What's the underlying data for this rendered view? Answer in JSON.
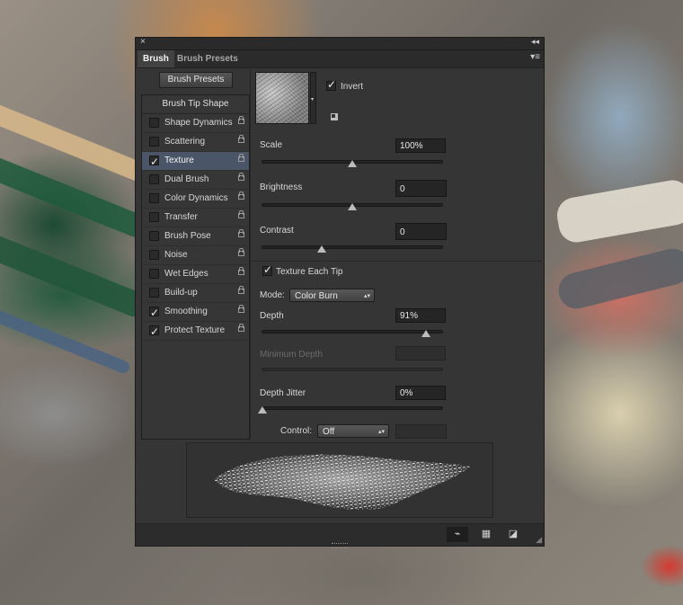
{
  "window": {
    "close_symbol": "×",
    "collapse_symbol": "◂◂",
    "menu_symbol": "▾≡"
  },
  "tabs": [
    "Brush",
    "Brush Presets"
  ],
  "sidebar": {
    "presets_button": "Brush Presets",
    "header": "Brush Tip Shape",
    "items": [
      {
        "label": "Shape Dynamics",
        "checked": false
      },
      {
        "label": "Scattering",
        "checked": false
      },
      {
        "label": "Texture",
        "checked": true,
        "selected": true
      },
      {
        "label": "Dual Brush",
        "checked": false
      },
      {
        "label": "Color Dynamics",
        "checked": false
      },
      {
        "label": "Transfer",
        "checked": false
      },
      {
        "label": "Brush Pose",
        "checked": false
      },
      {
        "label": "Noise",
        "checked": false
      },
      {
        "label": "Wet Edges",
        "checked": false
      },
      {
        "label": "Build-up",
        "checked": false
      },
      {
        "label": "Smoothing",
        "checked": true
      },
      {
        "label": "Protect Texture",
        "checked": true
      }
    ]
  },
  "texture": {
    "invert_label": "Invert",
    "invert_checked": true,
    "scale": {
      "label": "Scale",
      "value": "100%",
      "slider": 0.5
    },
    "brightness": {
      "label": "Brightness",
      "value": "0",
      "slider": 0.5
    },
    "contrast": {
      "label": "Contrast",
      "value": "0",
      "slider": 0.33
    },
    "texture_each_tip": {
      "label": "Texture Each Tip",
      "checked": true
    },
    "mode": {
      "label": "Mode:",
      "value": "Color Burn"
    },
    "depth": {
      "label": "Depth",
      "value": "91%",
      "slider": 0.91
    },
    "minimum_depth": {
      "label": "Minimum Depth",
      "value": "",
      "disabled": true
    },
    "depth_jitter": {
      "label": "Depth Jitter",
      "value": "0%",
      "slider": 0.0
    },
    "control": {
      "label": "Control:",
      "value": "Off"
    }
  },
  "icons": {
    "toggle_bristle_preview": "brush-preview-icon",
    "open_preset_manager": "grid-icon",
    "create_new_brush": "new-brush-icon"
  },
  "colors": {
    "panel_bg": "#353535",
    "selected_row": "#4b5568"
  }
}
